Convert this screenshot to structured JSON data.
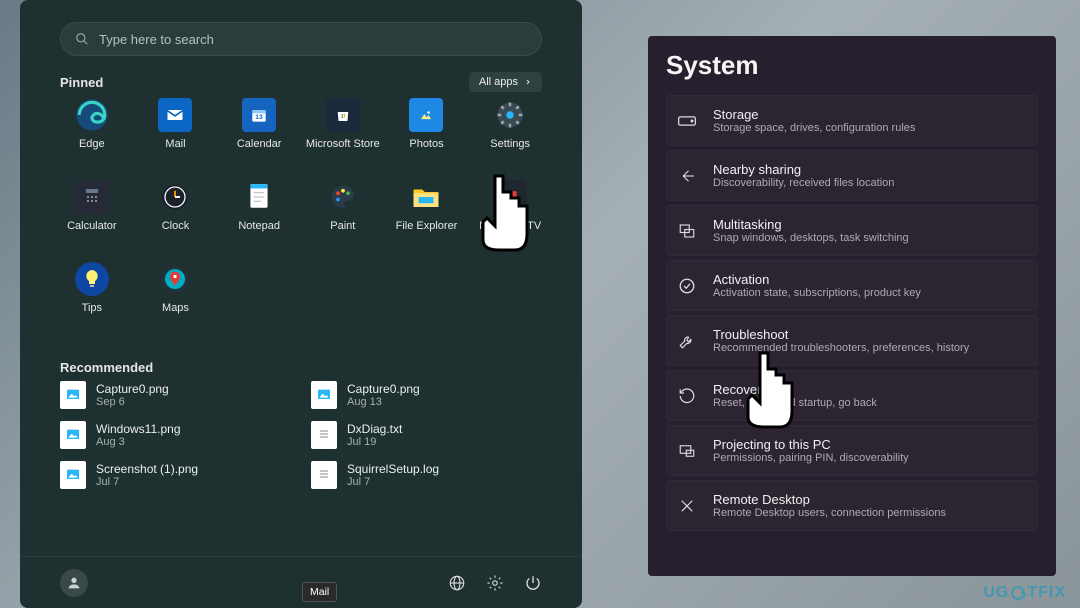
{
  "search": {
    "placeholder": "Type here to search"
  },
  "pinned": {
    "title": "Pinned",
    "all_apps_label": "All apps",
    "items": [
      {
        "label": "Edge"
      },
      {
        "label": "Mail"
      },
      {
        "label": "Calendar"
      },
      {
        "label": "Microsoft Store"
      },
      {
        "label": "Photos"
      },
      {
        "label": "Settings"
      },
      {
        "label": "Calculator"
      },
      {
        "label": "Clock"
      },
      {
        "label": "Notepad"
      },
      {
        "label": "Paint"
      },
      {
        "label": "File Explorer"
      },
      {
        "label": "Movies & TV"
      },
      {
        "label": "Tips"
      },
      {
        "label": "Maps"
      }
    ]
  },
  "recommended": {
    "title": "Recommended",
    "items": [
      {
        "name": "Capture0.png",
        "date": "Sep 6",
        "type": "image"
      },
      {
        "name": "Capture0.png",
        "date": "Aug 13",
        "type": "image"
      },
      {
        "name": "Windows11.png",
        "date": "Aug 3",
        "type": "image"
      },
      {
        "name": "DxDiag.txt",
        "date": "Jul 19",
        "type": "text"
      },
      {
        "name": "Screenshot (1).png",
        "date": "Jul 7",
        "type": "image"
      },
      {
        "name": "SquirrelSetup.log",
        "date": "Jul 7",
        "type": "text"
      }
    ]
  },
  "tooltip": "Mail",
  "settings": {
    "title": "System",
    "rows": [
      {
        "title": "Storage",
        "desc": "Storage space, drives, configuration rules"
      },
      {
        "title": "Nearby sharing",
        "desc": "Discoverability, received files location"
      },
      {
        "title": "Multitasking",
        "desc": "Snap windows, desktops, task switching"
      },
      {
        "title": "Activation",
        "desc": "Activation state, subscriptions, product key"
      },
      {
        "title": "Troubleshoot",
        "desc": "Recommended troubleshooters, preferences, history"
      },
      {
        "title": "Recovery",
        "desc": "Reset, advanced startup, go back"
      },
      {
        "title": "Projecting to this PC",
        "desc": "Permissions, pairing PIN, discoverability"
      },
      {
        "title": "Remote Desktop",
        "desc": "Remote Desktop users, connection permissions"
      }
    ]
  },
  "watermark": {
    "a": "UG",
    "b": "TFIX"
  }
}
